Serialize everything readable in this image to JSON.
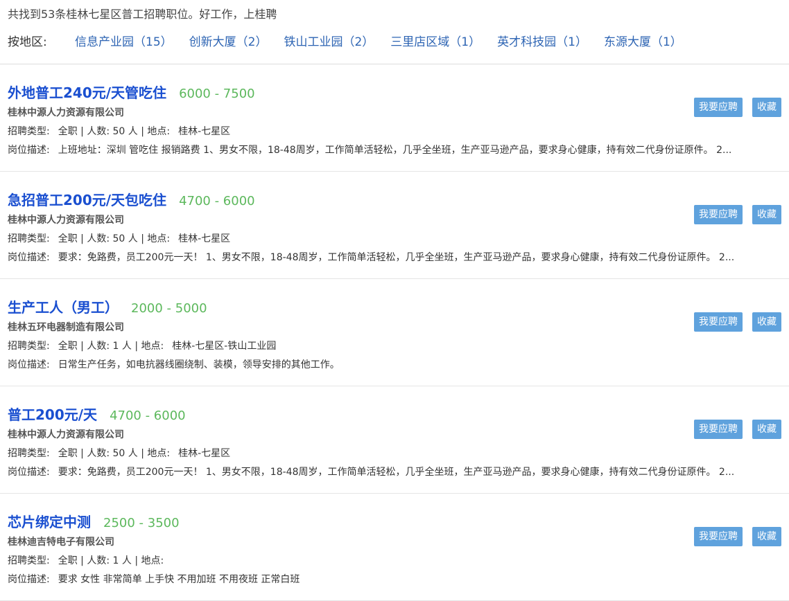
{
  "summary": "共找到53条桂林七星区普工招聘职位。好工作，上桂聘",
  "area_filter": {
    "label": "按地区:",
    "items": [
      {
        "label": "信息产业园（15）"
      },
      {
        "label": "创新大厦（2）"
      },
      {
        "label": "铁山工业园（2）"
      },
      {
        "label": "三里店区域（1）"
      },
      {
        "label": "英才科技园（1）"
      },
      {
        "label": "东源大厦（1）"
      }
    ]
  },
  "labels": {
    "type": "招聘类型:",
    "count": "人数:",
    "location": "地点:",
    "description": "岗位描述:",
    "apply": "我要应聘",
    "favorite": "收藏"
  },
  "colors": {
    "title": "#1a4fd0",
    "salary": "#5cb85c",
    "button": "#5fa2dd",
    "area_link": "#2d64b3"
  },
  "jobs": [
    {
      "title": "外地普工240元/天管吃住",
      "salary": "6000 - 7500",
      "company": "桂林中源人力资源有限公司",
      "type": "全职",
      "count": "50 人",
      "location": "桂林-七星区",
      "description": "上班地址：深圳 管吃住 报销路费 1、男女不限，18-48周岁，工作简单活轻松，几乎全坐班，生产亚马逊产品，要求身心健康，持有效二代身份证原件。 2..."
    },
    {
      "title": "急招普工200元/天包吃住",
      "salary": "4700 - 6000",
      "company": "桂林中源人力资源有限公司",
      "type": "全职",
      "count": "50 人",
      "location": "桂林-七星区",
      "description": "要求：免路费，员工200元一天！ 1、男女不限，18-48周岁，工作简单活轻松，几乎全坐班，生产亚马逊产品，要求身心健康，持有效二代身份证原件。 2..."
    },
    {
      "title": "生产工人（男工）",
      "salary": "2000 - 5000",
      "company": "桂林五环电器制造有限公司",
      "type": "全职",
      "count": "1 人",
      "location": "桂林-七星区-铁山工业园",
      "description": "日常生产任务，如电抗器线圈绕制、装模，领导安排的其他工作。"
    },
    {
      "title": "普工200元/天",
      "salary": "4700 - 6000",
      "company": "桂林中源人力资源有限公司",
      "type": "全职",
      "count": "50 人",
      "location": "桂林-七星区",
      "description": "要求：免路费，员工200元一天！ 1、男女不限，18-48周岁，工作简单活轻松，几乎全坐班，生产亚马逊产品，要求身心健康，持有效二代身份证原件。 2..."
    },
    {
      "title": "芯片绑定中测",
      "salary": "2500 - 3500",
      "company": "桂林迪吉特电子有限公司",
      "type": "全职",
      "count": "1 人",
      "location": "",
      "description": "要求 女性 非常简单 上手快 不用加班 不用夜班 正常白班"
    }
  ]
}
